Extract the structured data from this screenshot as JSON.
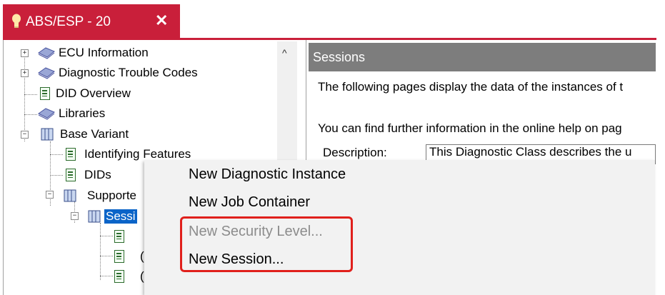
{
  "tab": {
    "title": "ABS/ESP - 20",
    "close": "✕"
  },
  "tree": {
    "nodes": [
      {
        "label": "ECU Information"
      },
      {
        "label": "Diagnostic Trouble Codes"
      },
      {
        "label": "DID Overview"
      },
      {
        "label": "Libraries"
      },
      {
        "label": "Base Variant"
      },
      {
        "label": "Identifying Features"
      },
      {
        "label": "DIDs"
      },
      {
        "label": "Supporte"
      },
      {
        "label": "Sessi"
      }
    ],
    "child_partials": [
      "(",
      "(",
      "("
    ]
  },
  "panel": {
    "header": "Sessions",
    "line1": "The following pages display the data of the instances of t",
    "line2": "You can find further information in the online help on pag",
    "description_label": "Description:",
    "description_value": "This Diagnostic Class describes the u"
  },
  "context_menu": {
    "items": [
      {
        "label": "New Diagnostic Instance",
        "enabled": true
      },
      {
        "label": "New Job Container",
        "enabled": true
      },
      {
        "label": "New Security Level...",
        "enabled": false
      },
      {
        "label": "New Session...",
        "enabled": true
      }
    ],
    "highlight_color": "#e0201c"
  },
  "colors": {
    "tab_accent": "#c91f3a",
    "selection": "#0a64c8",
    "panel_header": "#7d7d7d"
  }
}
